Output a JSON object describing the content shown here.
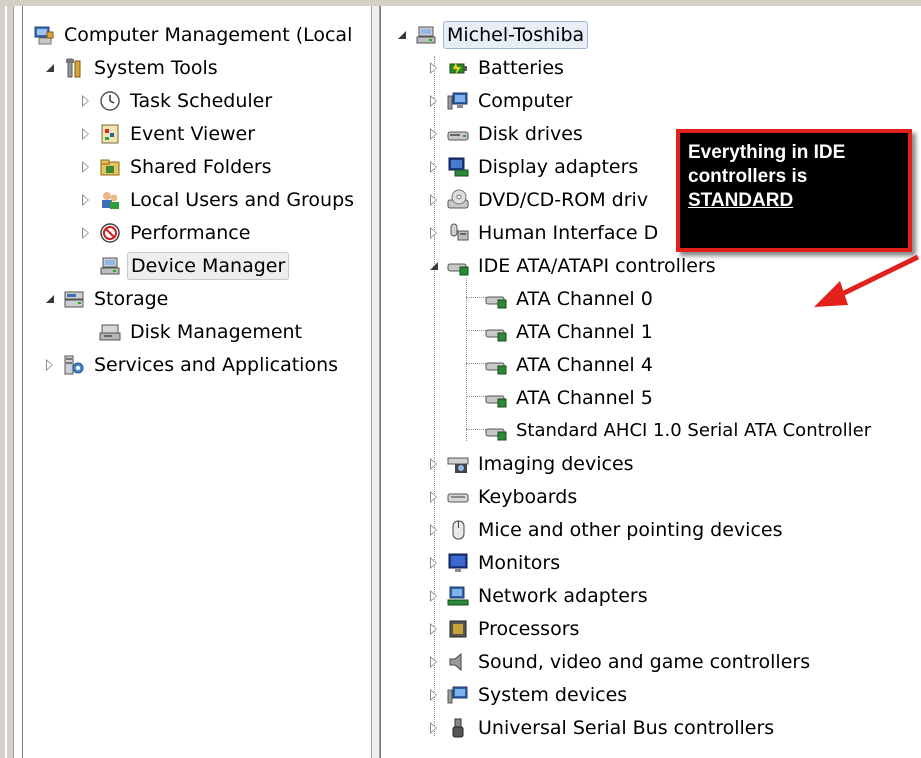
{
  "left_tree": {
    "items": [
      {
        "label": "Computer Management (Local",
        "icon": "computer-management-icon"
      },
      {
        "label": "System Tools",
        "icon": "tools-icon"
      },
      {
        "label": "Task Scheduler",
        "icon": "clock-icon"
      },
      {
        "label": "Event Viewer",
        "icon": "event-viewer-icon"
      },
      {
        "label": "Shared Folders",
        "icon": "shared-folder-icon"
      },
      {
        "label": "Local Users and Groups",
        "icon": "users-icon"
      },
      {
        "label": "Performance",
        "icon": "performance-icon"
      },
      {
        "label": "Device Manager",
        "icon": "device-manager-icon"
      },
      {
        "label": "Storage",
        "icon": "storage-icon"
      },
      {
        "label": "Disk Management",
        "icon": "disk-management-icon"
      },
      {
        "label": "Services and Applications",
        "icon": "services-icon"
      }
    ]
  },
  "right_tree": {
    "root": {
      "label": "Michel-Toshiba",
      "icon": "computer-root-icon"
    },
    "items": [
      {
        "label": "Batteries",
        "icon": "battery-icon"
      },
      {
        "label": "Computer",
        "icon": "computer-icon"
      },
      {
        "label": "Disk drives",
        "icon": "disk-drive-icon"
      },
      {
        "label": "Display adapters",
        "icon": "display-adapter-icon"
      },
      {
        "label": "DVD/CD-ROM driv",
        "icon": "dvd-icon"
      },
      {
        "label": "Human Interface D",
        "icon": "hid-icon"
      },
      {
        "label": "IDE ATA/ATAPI controllers",
        "icon": "ide-controller-icon"
      },
      {
        "label": "ATA Channel 0",
        "icon": "ata-channel-icon"
      },
      {
        "label": "ATA Channel 1",
        "icon": "ata-channel-icon"
      },
      {
        "label": "ATA Channel 4",
        "icon": "ata-channel-icon"
      },
      {
        "label": "ATA Channel 5",
        "icon": "ata-channel-icon"
      },
      {
        "label": "Standard AHCI 1.0 Serial ATA Controller",
        "icon": "ata-channel-icon"
      },
      {
        "label": "Imaging devices",
        "icon": "imaging-icon"
      },
      {
        "label": "Keyboards",
        "icon": "keyboard-icon"
      },
      {
        "label": "Mice and other pointing devices",
        "icon": "mouse-icon"
      },
      {
        "label": "Monitors",
        "icon": "monitor-icon"
      },
      {
        "label": "Network adapters",
        "icon": "network-icon"
      },
      {
        "label": "Processors",
        "icon": "processor-icon"
      },
      {
        "label": "Sound, video and game controllers",
        "icon": "speaker-icon"
      },
      {
        "label": "System devices",
        "icon": "system-device-icon"
      },
      {
        "label": "Universal Serial Bus controllers",
        "icon": "usb-icon"
      }
    ]
  },
  "callout": {
    "line1": "Everything in IDE",
    "line2": "controllers is",
    "line3": "STANDARD"
  },
  "colors": {
    "callout_border": "#e2211c",
    "callout_bg": "#000000",
    "callout_text": "#ffffff"
  }
}
